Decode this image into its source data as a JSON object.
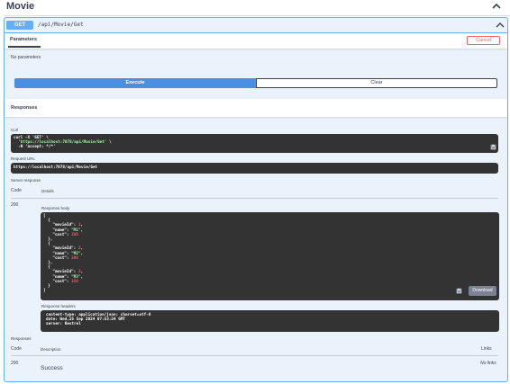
{
  "tag": {
    "title": "Movie"
  },
  "operation": {
    "method": "GET",
    "path": "/api/Movie/Get"
  },
  "parameters": {
    "tab_label": "Parameters",
    "cancel_label": "Cancel",
    "empty_text": "No parameters"
  },
  "actions": {
    "execute_label": "Execute",
    "clear_label": "Clear"
  },
  "responses_section": {
    "title": "Responses"
  },
  "curl": {
    "label": "Curl",
    "line1_prefix": "curl -X 'GET' \\",
    "line2_url": "'https://localhost:7078/api/Movie/Get'",
    "line2_suffix": " \\",
    "line3_prefix": "-H 'accept: */*'"
  },
  "request_url": {
    "label": "Request URL",
    "value": "https://localhost:7078/api/Movie/Get"
  },
  "server_response": {
    "label": "Server response",
    "col_code": "Code",
    "col_details": "Details",
    "status_code": "200",
    "body_label": "Response body",
    "movies": [
      {
        "movieId": "1",
        "name": "\"M1\"",
        "cost": "100"
      },
      {
        "movieId": "2",
        "name": "\"M2\"",
        "cost": "200"
      },
      {
        "movieId": "3",
        "name": "\"M3\"",
        "cost": "150"
      }
    ],
    "download_label": "Download",
    "headers_label": "Response headers",
    "headers": [
      "content-type: application/json; charset=utf-8",
      "date: Wed,25 Sep 2024 07:53:24 GMT",
      "server: Kestrel"
    ]
  },
  "responses_table": {
    "label": "Responses",
    "col_code": "Code",
    "col_description": "Description",
    "col_links": "Links",
    "row_code": "200",
    "row_description": "Success",
    "row_links": "No links"
  },
  "colors": {
    "get_blue": "#61affe",
    "execute_blue": "#4990e2",
    "cancel_red": "#ff6060",
    "code_bg": "#333333"
  },
  "icons": {
    "collapse": "chevron-up-icon",
    "copy": "clipboard-icon"
  }
}
